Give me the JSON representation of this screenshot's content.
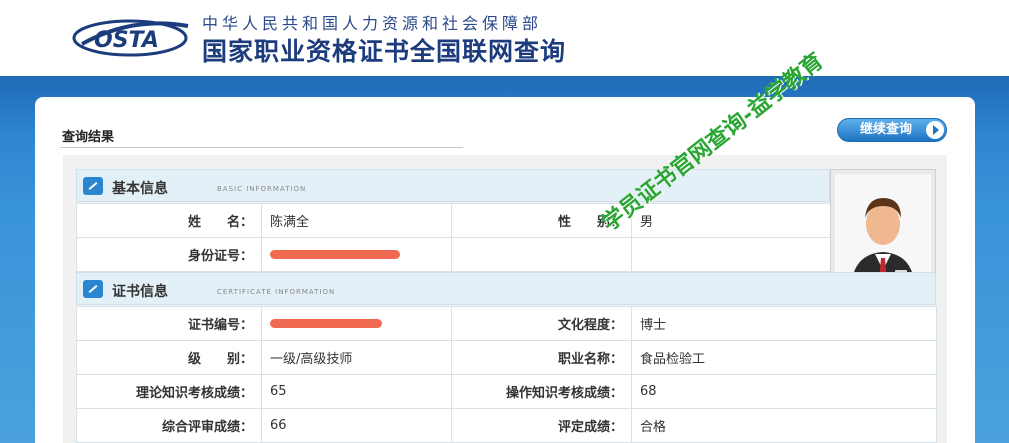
{
  "header": {
    "logo_text": "OSTA",
    "org_name": "中华人民共和国人力资源和社会保障部",
    "site_title": "国家职业资格证书全国联网查询"
  },
  "watermark": "学员证书官网查询-益学教育",
  "card": {
    "title": "查询结果",
    "continue_button": "继续查询"
  },
  "basic_info": {
    "title": "基本信息",
    "subtitle": "BASIC INFORMATION",
    "rows": [
      {
        "label1": "姓　　名：",
        "value1": "陈满全",
        "label2": "性　　别：",
        "value2": "男"
      },
      {
        "label1": "身份证号：",
        "value1": "",
        "label2": "",
        "value2": ""
      }
    ]
  },
  "cert_info": {
    "title": "证书信息",
    "subtitle": "CERTIFICATE INFORMATION",
    "rows": [
      {
        "label1": "证书编号：",
        "value1": "",
        "label2": "文化程度：",
        "value2": "博士"
      },
      {
        "label1": "级　　别：",
        "value1": "一级/高级技师",
        "label2": "职业名称：",
        "value2": "食品检验工"
      },
      {
        "label1": "理论知识考核成绩：",
        "value1": "65",
        "label2": "操作知识考核成绩：",
        "value2": "68"
      },
      {
        "label1": "综合评审成绩：",
        "value1": "66",
        "label2": "评定成绩：",
        "value2": "合格"
      }
    ]
  },
  "colors": {
    "band_blue": "#2e86d0",
    "title_blue": "#1d3c7e",
    "section_bg": "#e4f0f7",
    "redaction": "#f06a52",
    "watermark_green": "#2aa632"
  }
}
